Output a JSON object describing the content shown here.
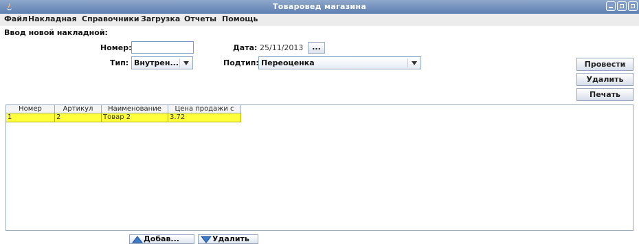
{
  "window": {
    "title": "Товаровед магазина",
    "accent": "#5d7fb1"
  },
  "menu": [
    "Файл",
    "Накладная",
    "Справочники",
    "Загрузка",
    "Отчеты",
    "Помощь"
  ],
  "form": {
    "section_title": "Ввод новой накладной:",
    "number_label": "Номер:",
    "number_value": "",
    "date_label": "Дата:",
    "date_value": "25/11/2013",
    "date_button": "...",
    "type_label": "Тип:",
    "type_value": "Внутрен...",
    "subtype_label": "Подтип:",
    "subtype_value": "Переоценка"
  },
  "actions": {
    "post": "Провести",
    "delete": "Удалить",
    "print": "Печать"
  },
  "table": {
    "columns": [
      "Номер",
      "Артикул",
      "Наименование",
      "Цена продажи с НДС"
    ],
    "rows": [
      [
        "1",
        "2",
        "Товар 2",
        "3.72"
      ]
    ],
    "selected_row_color": "#ffff3c"
  },
  "bottom": {
    "add": "Добав...",
    "remove": "Удалить"
  }
}
